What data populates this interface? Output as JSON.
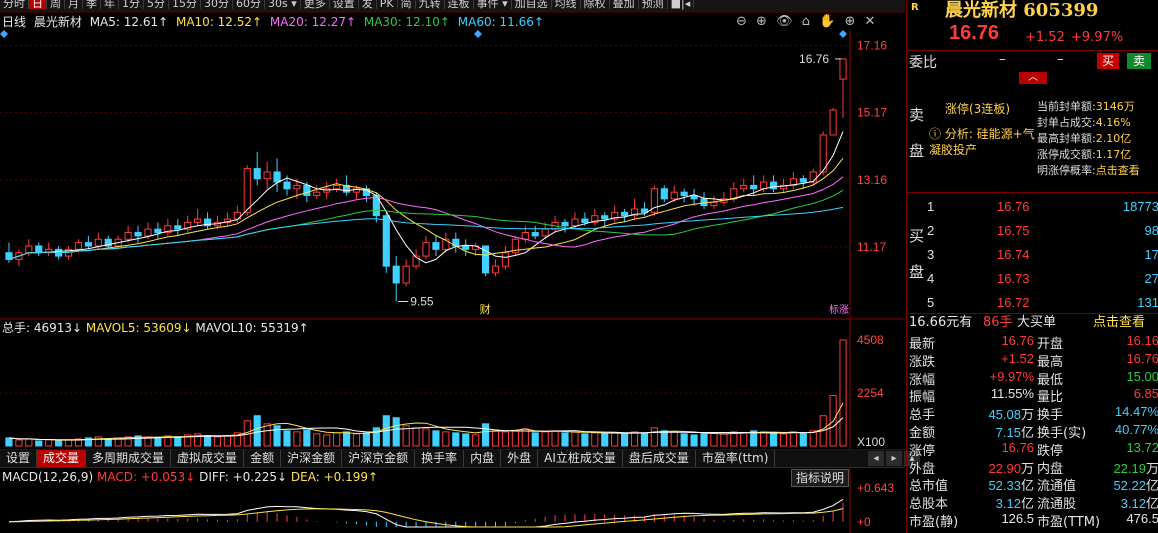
{
  "period_tabs": [
    "分时",
    "日",
    "周",
    "月",
    "季",
    "年",
    "1分",
    "5分",
    "15分",
    "30分",
    "60分",
    "30s ▾",
    "更多",
    "设置",
    "",
    "发",
    "PK",
    "简",
    "九转",
    "连板",
    "事件 ▾",
    "",
    "加自选",
    "均线",
    "除权",
    "叠加",
    "预测",
    "■|◂"
  ],
  "period_active": "日",
  "chart_header": {
    "chart_type": "日线",
    "stock_name": "晨光新材",
    "ma5": "MA5: 12.61↑",
    "ma10": "MA10: 12.52↑",
    "ma20": "MA20: 12.27↑",
    "ma30": "MA30: 12.10↑",
    "ma60": "MA60: 11.66↑"
  },
  "chart_tools": [
    "⊖",
    "⊕",
    "👁",
    "⌂",
    "✋",
    "⊕",
    "✕"
  ],
  "price_axis": [
    "17.16",
    "15.17",
    "13.16",
    "11.17"
  ],
  "annotations": {
    "high": "16.76",
    "low": "9.55",
    "cai": "财",
    "limit_tag": "标涨"
  },
  "volume": {
    "total": "总手: 46913↓",
    "mavol5": "MAVOL5: 53609↓",
    "mavol10": "MAVOL10: 55319↑",
    "axis": [
      "4508",
      "2254",
      "X100"
    ]
  },
  "indicator_tabs": [
    "设置",
    "成交量",
    "多周期成交量",
    "虚拟成交量",
    "金额",
    "沪深金额",
    "沪深京金额",
    "换手率",
    "内盘",
    "外盘",
    "AI立桩成交量",
    "盘后成交量",
    "市盈率(ttm)"
  ],
  "indicator_active": "成交量",
  "indicator_nav": [
    "◂",
    "▸",
    "▴"
  ],
  "macd": {
    "name": "MACD(12,26,9)",
    "macd": "MACD: +0.053↓",
    "diff": "DIFF: +0.225↓",
    "dea": "DEA: +0.199↑",
    "help": "指标说明",
    "axis": [
      "+0.643",
      "+0"
    ]
  },
  "stock": {
    "badge": "R",
    "name": "晨光新材",
    "code": "605399",
    "price": "16.76",
    "change": "+1.52",
    "pct": "+9.97%"
  },
  "weibi": {
    "label": "委比",
    "v1": "–",
    "v2": "–",
    "buy": "买",
    "sell": "卖",
    "collapse": "︿"
  },
  "limit": {
    "sell_side": [
      "卖",
      "盘"
    ],
    "title": "涨停(3连板)",
    "analysis": "ⓘ 分析: 硅能源+气凝胶投产",
    "stats": [
      {
        "k": "当前封单额:",
        "v": "3146万"
      },
      {
        "k": "封单占成交:",
        "v": "4.16%"
      },
      {
        "k": "最高封单额:",
        "v": "2.10亿"
      },
      {
        "k": "涨停成交额:",
        "v": "1.17亿"
      },
      {
        "k": "明涨停概率:",
        "v": "点击查看"
      }
    ]
  },
  "buy_book": {
    "side": [
      "买",
      "盘"
    ],
    "rows": [
      {
        "lv": "1",
        "price": "16.76",
        "vol": "18773"
      },
      {
        "lv": "2",
        "price": "16.75",
        "vol": "98"
      },
      {
        "lv": "3",
        "price": "16.74",
        "vol": "17"
      },
      {
        "lv": "4",
        "price": "16.73",
        "vol": "27"
      },
      {
        "lv": "5",
        "price": "16.72",
        "vol": "131"
      }
    ]
  },
  "big_order": {
    "amount": "16.66元有",
    "hands": "86手",
    "label": "大买单",
    "link": "点击查看"
  },
  "stats": [
    {
      "k1": "最新",
      "v1": "16.76",
      "u1": "",
      "c1": "red",
      "k2": "开盘",
      "v2": "16.16",
      "u2": "",
      "c2": "red"
    },
    {
      "k1": "涨跌",
      "v1": "+1.52",
      "u1": "",
      "c1": "red",
      "k2": "最高",
      "v2": "16.76",
      "u2": "",
      "c2": "red"
    },
    {
      "k1": "涨幅",
      "v1": "+9.97%",
      "u1": "",
      "c1": "red",
      "k2": "最低",
      "v2": "15.00",
      "u2": "",
      "c2": "green"
    },
    {
      "k1": "振幅",
      "v1": "11.55%",
      "u1": "",
      "c1": "white",
      "k2": "量比",
      "v2": "6.85",
      "u2": "",
      "c2": "red"
    },
    {
      "k1": "总手",
      "v1": "45.08",
      "u1": "万",
      "c1": "cyan",
      "k2": "换手",
      "v2": "14.47%",
      "u2": "",
      "c2": "cyan"
    },
    {
      "k1": "金额",
      "v1": "7.15",
      "u1": "亿",
      "c1": "cyan",
      "k2": "换手(实)",
      "v2": "40.77%",
      "u2": "",
      "c2": "cyan"
    },
    {
      "k1": "涨停",
      "v1": "16.76",
      "u1": "",
      "c1": "red",
      "k2": "跌停",
      "v2": "13.72",
      "u2": "",
      "c2": "green"
    },
    {
      "k1": "外盘",
      "v1": "22.90",
      "u1": "万",
      "c1": "red",
      "k2": "内盘",
      "v2": "22.19",
      "u2": "万",
      "c2": "green"
    },
    {
      "k1": "总市值",
      "v1": "52.33",
      "u1": "亿",
      "c1": "cyan",
      "k2": "流通值",
      "v2": "52.22",
      "u2": "亿",
      "c2": "cyan"
    },
    {
      "k1": "总股本",
      "v1": "3.12",
      "u1": "亿",
      "c1": "cyan",
      "k2": "流通股",
      "v2": "3.12",
      "u2": "亿",
      "c2": "cyan"
    },
    {
      "k1": "市盈(静)",
      "v1": "126.5",
      "u1": "",
      "c1": "white",
      "k2": "市盈(TTM)",
      "v2": "476.5",
      "u2": "",
      "c2": "white"
    }
  ],
  "colors": {
    "up": "#ff3b3b",
    "down": "#2ecc40",
    "accent": "#b80000",
    "ma5": "#ffffff",
    "ma10": "#ffe14a",
    "ma20": "#ff6cff",
    "ma30": "#2ecc40",
    "ma60": "#3fd0ff"
  },
  "chart_data": {
    "type": "candlestick",
    "candles": [
      [
        11.0,
        10.8,
        11.3,
        10.7
      ],
      [
        10.8,
        11.0,
        11.1,
        10.6
      ],
      [
        11.0,
        11.2,
        11.4,
        10.9
      ],
      [
        11.2,
        11.0,
        11.3,
        10.9
      ],
      [
        11.0,
        11.1,
        11.3,
        10.9
      ],
      [
        11.1,
        10.9,
        11.2,
        10.8
      ],
      [
        10.9,
        11.1,
        11.2,
        10.8
      ],
      [
        11.1,
        11.3,
        11.4,
        11.0
      ],
      [
        11.3,
        11.2,
        11.5,
        11.1
      ],
      [
        11.2,
        11.4,
        11.6,
        11.1
      ],
      [
        11.4,
        11.2,
        11.5,
        11.1
      ],
      [
        11.2,
        11.4,
        11.5,
        11.1
      ],
      [
        11.4,
        11.6,
        11.8,
        11.3
      ],
      [
        11.6,
        11.5,
        11.8,
        11.3
      ],
      [
        11.5,
        11.7,
        11.9,
        11.4
      ],
      [
        11.7,
        11.6,
        11.9,
        11.4
      ],
      [
        11.6,
        11.8,
        12.0,
        11.5
      ],
      [
        11.8,
        11.7,
        12.0,
        11.5
      ],
      [
        11.7,
        11.9,
        12.1,
        11.6
      ],
      [
        11.9,
        12.0,
        12.3,
        11.8
      ],
      [
        12.0,
        11.8,
        12.2,
        11.7
      ],
      [
        11.8,
        11.9,
        12.1,
        11.7
      ],
      [
        11.9,
        12.0,
        12.2,
        11.8
      ],
      [
        12.0,
        12.2,
        12.4,
        11.9
      ],
      [
        12.2,
        13.5,
        13.6,
        12.1
      ],
      [
        13.5,
        13.2,
        14.0,
        13.0
      ],
      [
        13.2,
        13.4,
        13.7,
        12.9
      ],
      [
        13.4,
        13.1,
        13.8,
        12.8
      ],
      [
        13.1,
        12.9,
        13.3,
        12.7
      ],
      [
        12.9,
        13.0,
        13.2,
        12.6
      ],
      [
        13.0,
        12.7,
        13.1,
        12.5
      ],
      [
        12.7,
        12.8,
        13.0,
        12.6
      ],
      [
        12.8,
        12.9,
        13.1,
        12.6
      ],
      [
        12.9,
        13.0,
        13.2,
        12.8
      ],
      [
        13.0,
        12.8,
        13.3,
        12.7
      ],
      [
        12.8,
        12.9,
        13.0,
        12.6
      ],
      [
        12.9,
        12.7,
        13.0,
        12.5
      ],
      [
        12.7,
        12.1,
        12.8,
        11.9
      ],
      [
        12.1,
        10.6,
        12.2,
        10.4
      ],
      [
        10.6,
        10.1,
        10.9,
        9.55
      ],
      [
        10.1,
        10.6,
        10.8,
        10.0
      ],
      [
        10.6,
        10.9,
        11.1,
        10.5
      ],
      [
        10.9,
        11.3,
        11.5,
        10.8
      ],
      [
        11.3,
        11.1,
        11.5,
        10.9
      ],
      [
        11.1,
        11.4,
        11.6,
        11.0
      ],
      [
        11.4,
        11.2,
        11.6,
        11.0
      ],
      [
        11.2,
        11.1,
        11.4,
        10.9
      ],
      [
        11.1,
        11.2,
        11.3,
        10.9
      ],
      [
        11.2,
        10.4,
        11.2,
        10.3
      ],
      [
        10.4,
        10.6,
        10.8,
        10.3
      ],
      [
        10.6,
        11.0,
        11.2,
        10.5
      ],
      [
        11.0,
        11.4,
        11.5,
        10.9
      ],
      [
        11.4,
        11.6,
        11.8,
        11.3
      ],
      [
        11.6,
        11.5,
        11.8,
        11.4
      ],
      [
        11.5,
        11.7,
        11.9,
        11.4
      ],
      [
        11.7,
        11.9,
        12.1,
        11.6
      ],
      [
        11.9,
        11.8,
        12.0,
        11.6
      ],
      [
        11.8,
        12.0,
        12.2,
        11.7
      ],
      [
        12.0,
        11.9,
        12.2,
        11.8
      ],
      [
        11.9,
        12.1,
        12.3,
        11.8
      ],
      [
        12.1,
        12.0,
        12.2,
        11.8
      ],
      [
        12.0,
        12.2,
        12.4,
        11.9
      ],
      [
        12.2,
        12.1,
        12.3,
        11.9
      ],
      [
        12.1,
        12.3,
        12.6,
        12.0
      ],
      [
        12.3,
        12.2,
        12.5,
        12.1
      ],
      [
        12.2,
        12.9,
        13.0,
        12.1
      ],
      [
        12.9,
        12.6,
        13.0,
        12.5
      ],
      [
        12.6,
        12.8,
        13.0,
        12.5
      ],
      [
        12.8,
        12.7,
        12.9,
        12.5
      ],
      [
        12.7,
        12.6,
        12.9,
        12.4
      ],
      [
        12.6,
        12.4,
        12.8,
        12.3
      ],
      [
        12.4,
        12.5,
        12.7,
        12.3
      ],
      [
        12.5,
        12.6,
        12.8,
        12.4
      ],
      [
        12.6,
        12.9,
        13.1,
        12.5
      ],
      [
        12.9,
        13.0,
        13.2,
        12.8
      ],
      [
        13.0,
        12.9,
        13.3,
        12.7
      ],
      [
        12.9,
        13.1,
        13.3,
        12.8
      ],
      [
        13.1,
        12.9,
        13.3,
        12.8
      ],
      [
        12.9,
        13.0,
        13.2,
        12.8
      ],
      [
        13.0,
        13.2,
        13.4,
        12.9
      ],
      [
        13.2,
        13.1,
        13.3,
        12.9
      ],
      [
        13.1,
        13.4,
        13.5,
        13.0
      ],
      [
        13.4,
        14.5,
        14.6,
        13.3
      ],
      [
        14.5,
        15.24,
        15.3,
        14.5
      ],
      [
        16.16,
        16.76,
        16.76,
        15.0
      ]
    ],
    "volumes": [
      8,
      6,
      7,
      5,
      6,
      5,
      6,
      7,
      8,
      9,
      7,
      8,
      9,
      10,
      9,
      8,
      10,
      9,
      11,
      12,
      10,
      9,
      10,
      13,
      25,
      30,
      22,
      20,
      15,
      14,
      16,
      12,
      11,
      13,
      14,
      12,
      13,
      18,
      30,
      28,
      20,
      18,
      17,
      15,
      14,
      13,
      12,
      11,
      22,
      16,
      14,
      15,
      17,
      13,
      14,
      15,
      13,
      14,
      12,
      13,
      12,
      13,
      12,
      14,
      13,
      18,
      15,
      14,
      12,
      11,
      12,
      13,
      12,
      14,
      13,
      15,
      14,
      13,
      12,
      14,
      13,
      15,
      30,
      50,
      105
    ],
    "ylim": [
      9.0,
      17.5
    ],
    "vol_max": 4508,
    "macd_ylim": [
      -0.1,
      0.643
    ]
  }
}
